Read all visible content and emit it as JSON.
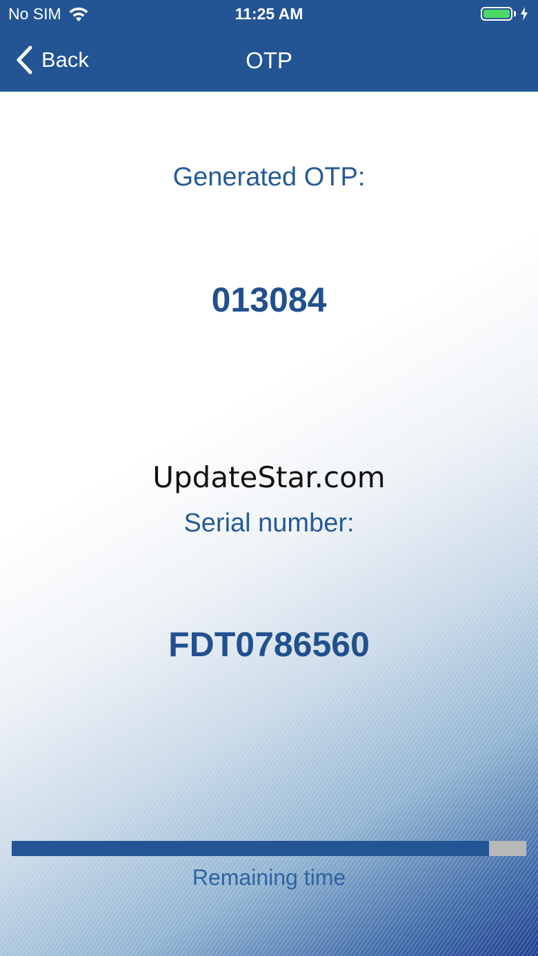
{
  "status_bar": {
    "carrier": "No SIM",
    "time": "11:25 AM",
    "battery_color": "#4cd964"
  },
  "nav": {
    "back_label": "Back",
    "title": "OTP"
  },
  "otp": {
    "label": "Generated OTP:",
    "value": "013084"
  },
  "watermark": "UpdateStar.com",
  "serial": {
    "label": "Serial number:",
    "value": "FDT0786560"
  },
  "timer": {
    "label": "Remaining time",
    "remaining_fraction": 0.927
  },
  "colors": {
    "brand": "#235594",
    "text_accent": "#265a96"
  },
  "icons": [
    "wifi-icon",
    "battery-icon",
    "charging-bolt-icon",
    "chevron-left-icon"
  ]
}
